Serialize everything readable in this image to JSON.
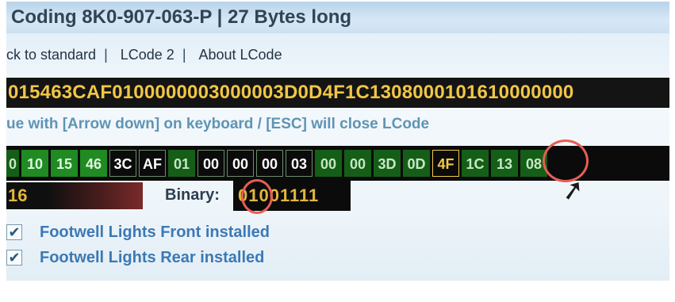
{
  "title": "Coding  8K0-907-063-P | 27 Bytes long",
  "menu": {
    "items": [
      "ck to standard",
      "LCode 2",
      "About LCode"
    ],
    "separator": "|"
  },
  "coding_string": "015463CAF0100000003000003D0D4F1C1308000101610000000",
  "hint": "ue with [Arrow down] on keyboard / [ESC] will close LCode",
  "bytes": [
    {
      "label": "0",
      "style": "gd"
    },
    {
      "label": "10",
      "style": "g"
    },
    {
      "label": "15",
      "style": "g"
    },
    {
      "label": "46",
      "style": "g"
    },
    {
      "label": "3C",
      "style": "k"
    },
    {
      "label": "AF",
      "style": "k"
    },
    {
      "label": "01",
      "style": "gd"
    },
    {
      "label": "00",
      "style": "k"
    },
    {
      "label": "00",
      "style": "k"
    },
    {
      "label": "00",
      "style": "k"
    },
    {
      "label": "03",
      "style": "k"
    },
    {
      "label": "00",
      "style": "gd"
    },
    {
      "label": "00",
      "style": "gd"
    },
    {
      "label": "3D",
      "style": "gd"
    },
    {
      "label": "0D",
      "style": "gd"
    },
    {
      "label": "4F",
      "style": "sel"
    },
    {
      "label": "1C",
      "style": "gd"
    },
    {
      "label": "13",
      "style": "gd"
    },
    {
      "label": "08",
      "style": "gd"
    }
  ],
  "value": {
    "text": "16"
  },
  "binary": {
    "label": "Binary:",
    "value": "01001111"
  },
  "options": [
    {
      "checked": true,
      "check_glyph": "✔",
      "label": "Footwell Lights Front installed"
    },
    {
      "checked": true,
      "check_glyph": "✔",
      "label": "Footwell Lights Rear installed"
    }
  ],
  "colors": {
    "accent_yellow": "#f0c646",
    "byte_green": "#1f8b22",
    "link_blue": "#3b79b5",
    "highlight_circle": "#e85d55"
  }
}
